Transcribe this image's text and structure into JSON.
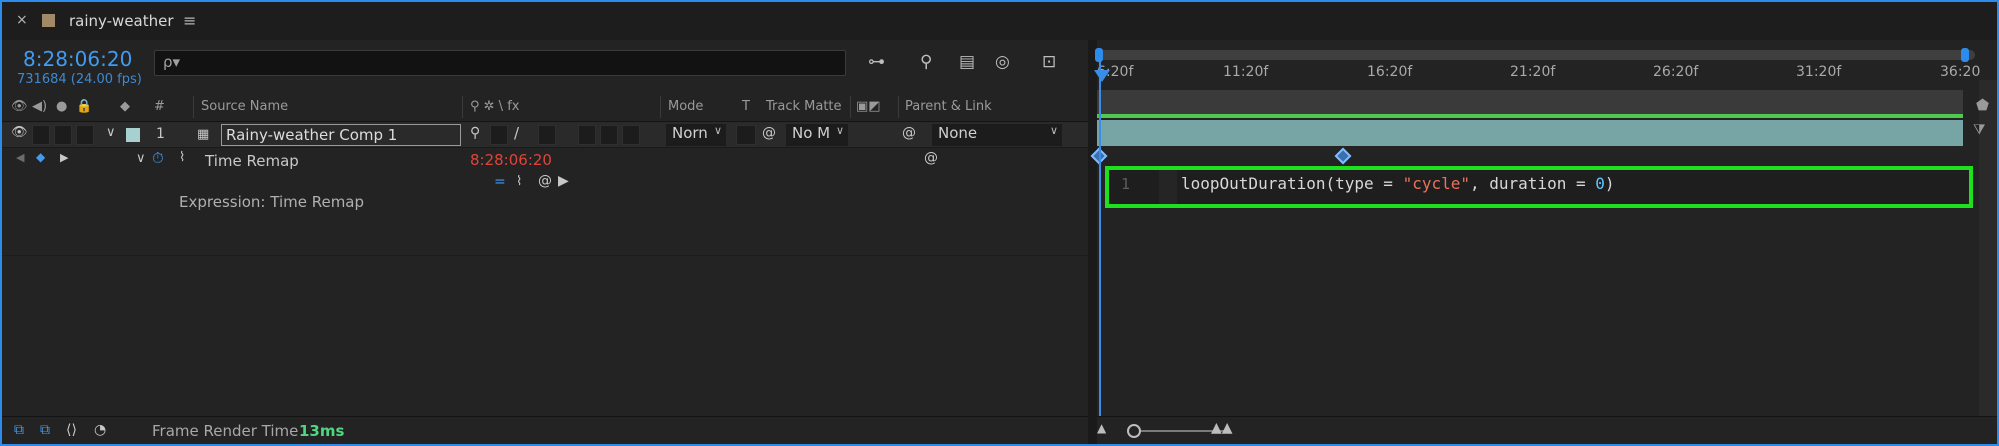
{
  "tab": {
    "close": "×",
    "title": "rainy-weather",
    "menu": "≡"
  },
  "header": {
    "timecode": "8:28:06:20",
    "framecount": "731684 (24.00 fps)",
    "search_icon": "ρ▾"
  },
  "columns": {
    "source_name": "Source Name",
    "number": "#",
    "mode": "Mode",
    "t": "T",
    "track_matte": "Track Matte",
    "parent_link": "Parent & Link",
    "switches": "⚲ ✲ \\ fx"
  },
  "layer": {
    "number": "1",
    "name": "Rainy-weather Comp 1",
    "mode": "Norn",
    "track_matte": "No M",
    "parent": "None"
  },
  "property": {
    "name": "Time Remap",
    "value": "8:28:06:20"
  },
  "expression": {
    "label": "Expression: Time Remap",
    "line_number": "1",
    "code_fn": "loopOutDuration(type = ",
    "code_str": "\"cycle\"",
    "code_mid": ", duration = ",
    "code_num": "0",
    "code_end": ")"
  },
  "footer": {
    "label": "Frame Render Time",
    "value": "13ms"
  },
  "timeline": {
    "ticks": [
      "6:20f",
      "11:20f",
      "16:20f",
      "21:20f",
      "26:20f",
      "31:20f",
      "36:20"
    ]
  },
  "colors": {
    "accent": "#2d8ceb",
    "timecode": "#3f9cf2",
    "remap_value": "#e0443a",
    "highlight": "#1ee01e",
    "layer_bar": "#77a5a5"
  }
}
